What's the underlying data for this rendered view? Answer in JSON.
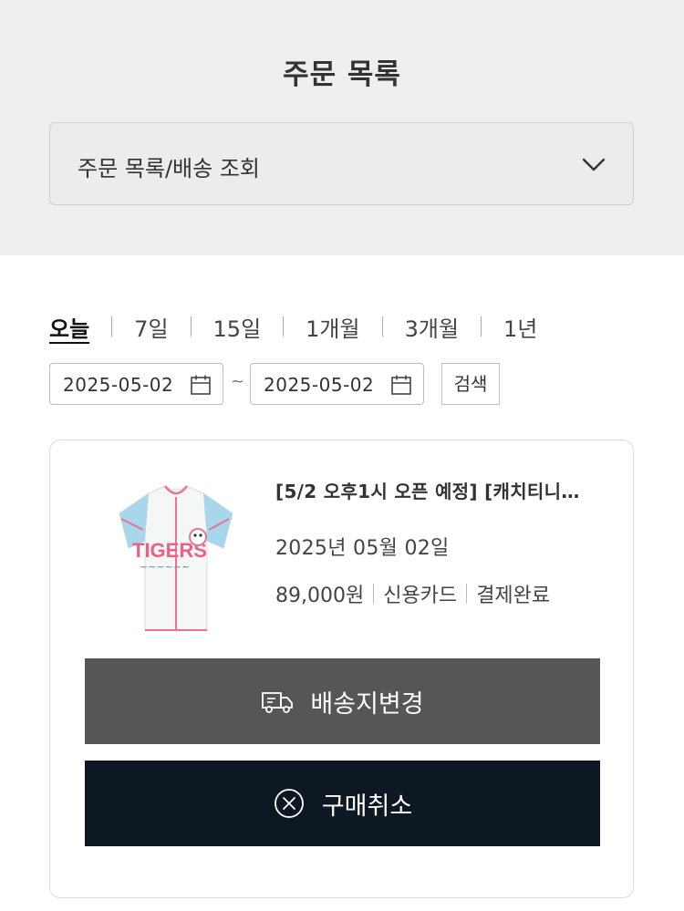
{
  "page_title": "주문 목록",
  "category_select": {
    "value": "주문 목록/배송 조회",
    "icon": "chevron-down-icon"
  },
  "period_tabs": [
    {
      "label": "오늘",
      "active": true
    },
    {
      "label": "7일",
      "active": false
    },
    {
      "label": "15일",
      "active": false
    },
    {
      "label": "1개월",
      "active": false
    },
    {
      "label": "3개월",
      "active": false
    },
    {
      "label": "1년",
      "active": false
    }
  ],
  "date_range": {
    "start": "2025-05-02",
    "separator": "~",
    "end": "2025-05-02",
    "icon": "calendar-icon"
  },
  "search_label": "검색",
  "order": {
    "product_name": "[5/2 오후1시 오픈 예정] [캐치티니…",
    "order_date": "2025년 05월 02일",
    "price": "89,000원",
    "payment_method": "신용카드",
    "status": "결제완료",
    "image_text": "TIGERS",
    "address_button": {
      "label": "배송지변경",
      "icon": "delivery-truck-icon"
    },
    "cancel_button": {
      "label": "구매취소",
      "icon": "cancel-circle-icon"
    }
  },
  "colors": {
    "header_bg": "#efefef",
    "address_button_bg": "#555658",
    "cancel_button_bg": "#0e1822"
  }
}
